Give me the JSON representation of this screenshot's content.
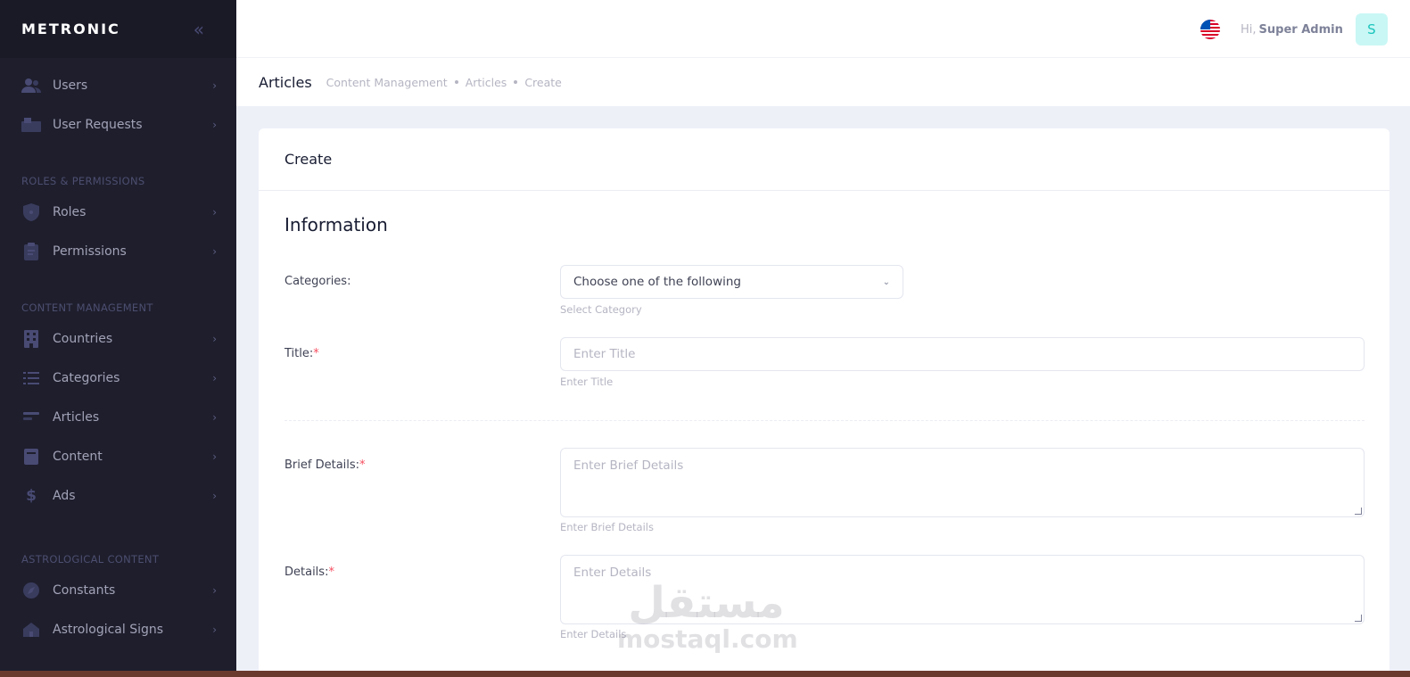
{
  "brand": "METRONIC",
  "sidebar": {
    "items_top": [
      {
        "label": "Users",
        "icon": "users-icon"
      },
      {
        "label": "User Requests",
        "icon": "building-icon"
      }
    ],
    "section_roles": "ROLES & PERMISSIONS",
    "items_roles": [
      {
        "label": "Roles",
        "icon": "shield-icon"
      },
      {
        "label": "Permissions",
        "icon": "clipboard-icon"
      }
    ],
    "section_content": "CONTENT MANAGEMENT",
    "items_content": [
      {
        "label": "Countries",
        "icon": "city-icon"
      },
      {
        "label": "Categories",
        "icon": "list-icon"
      },
      {
        "label": "Articles",
        "icon": "article-icon"
      },
      {
        "label": "Content",
        "icon": "box-icon"
      },
      {
        "label": "Ads",
        "icon": "dollar-icon"
      }
    ],
    "section_astro": "ASTROLOGICAL CONTENT",
    "items_astro": [
      {
        "label": "Constants",
        "icon": "compass-icon"
      },
      {
        "label": "Astrological Signs",
        "icon": "home-icon"
      }
    ]
  },
  "header": {
    "greeting": "Hi,",
    "username": "Super Admin",
    "avatar_letter": "S"
  },
  "subheader": {
    "title": "Articles",
    "breadcrumbs": [
      "Content Management",
      "Articles",
      "Create"
    ]
  },
  "card": {
    "title": "Create",
    "section_title": "Information",
    "fields": {
      "categories": {
        "label": "Categories:",
        "value": "Choose one of the following",
        "hint": "Select Category"
      },
      "title": {
        "label": "Title:",
        "placeholder": "Enter  Title",
        "hint": "Enter Title"
      },
      "brief": {
        "label": "Brief Details:",
        "placeholder": "Enter  Brief Details",
        "hint": "Enter Brief Details"
      },
      "details": {
        "label": "Details:",
        "placeholder": "Enter  Details",
        "hint": "Enter Details"
      }
    },
    "required_mark": "*"
  },
  "watermark": {
    "arabic": "مستقل",
    "latin": "mostaql.com"
  },
  "colors": {
    "sidebar_bg": "#1e1e2d",
    "brand_bg": "#1a1a27",
    "accent_teal": "#1bc5bd",
    "required": "#f64e60",
    "page_bg": "#eef0f8"
  }
}
